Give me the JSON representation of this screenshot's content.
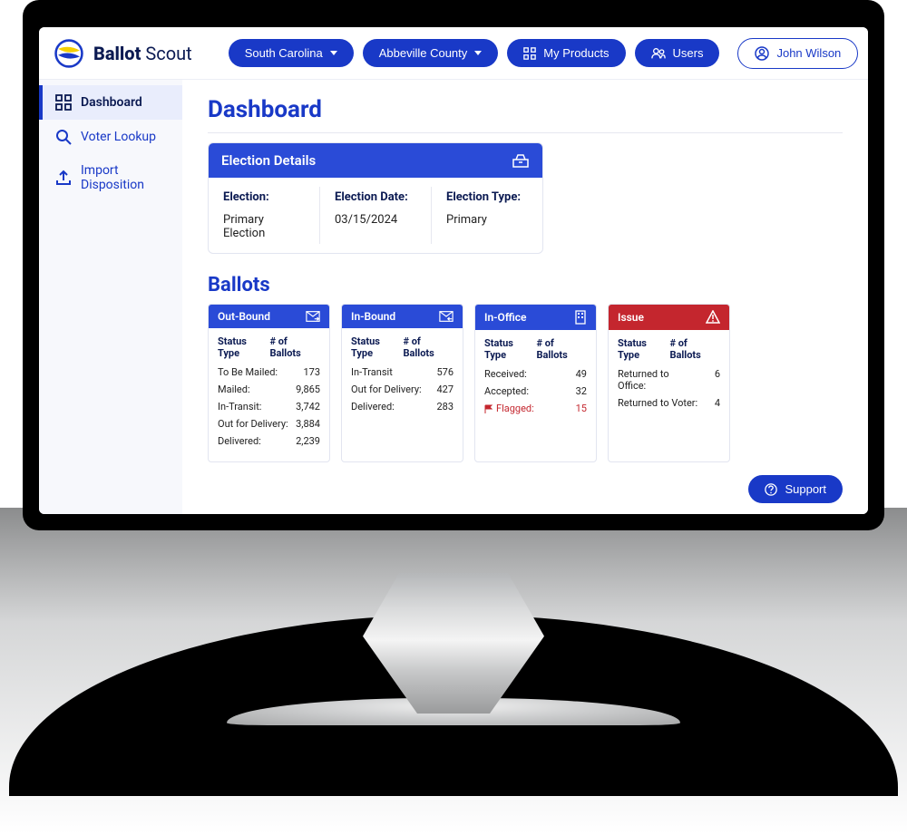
{
  "brand": {
    "strong": "Ballot",
    "light": "Scout"
  },
  "header": {
    "state": "South Carolina",
    "county": "Abbeville County",
    "products": "My Products",
    "users": "Users",
    "user": "John Wilson"
  },
  "sidebar": {
    "items": [
      {
        "label": "Dashboard"
      },
      {
        "label": "Voter Lookup"
      },
      {
        "label": "Import Disposition"
      }
    ]
  },
  "page": {
    "title": "Dashboard"
  },
  "election": {
    "header": "Election Details",
    "cols": [
      {
        "label": "Election:",
        "value": "Primary Election"
      },
      {
        "label": "Election Date:",
        "value": "03/15/2024"
      },
      {
        "label": "Election Type:",
        "value": "Primary"
      }
    ]
  },
  "ballots": {
    "title": "Ballots",
    "col_status": "Status Type",
    "col_count": "# of Ballots",
    "groups": [
      {
        "title": "Out-Bound",
        "style": "blue",
        "rows": [
          {
            "k": "To Be Mailed:",
            "v": "173"
          },
          {
            "k": "Mailed:",
            "v": "9,865"
          },
          {
            "k": "In-Transit:",
            "v": "3,742"
          },
          {
            "k": "Out for Delivery:",
            "v": "3,884"
          },
          {
            "k": "Delivered:",
            "v": "2,239"
          }
        ]
      },
      {
        "title": "In-Bound",
        "style": "blue",
        "rows": [
          {
            "k": "In-Transit",
            "v": "576"
          },
          {
            "k": "Out for Delivery:",
            "v": "427"
          },
          {
            "k": "Delivered:",
            "v": "283"
          }
        ]
      },
      {
        "title": "In-Office",
        "style": "blue",
        "rows": [
          {
            "k": "Received:",
            "v": "49"
          },
          {
            "k": "Accepted:",
            "v": "32"
          },
          {
            "k": "Flagged:",
            "v": "15",
            "flag": true
          }
        ]
      },
      {
        "title": "Issue",
        "style": "red",
        "rows": [
          {
            "k": "Returned to Office:",
            "v": "6"
          },
          {
            "k": "Returned to Voter:",
            "v": "4"
          }
        ]
      }
    ]
  },
  "support": "Support"
}
